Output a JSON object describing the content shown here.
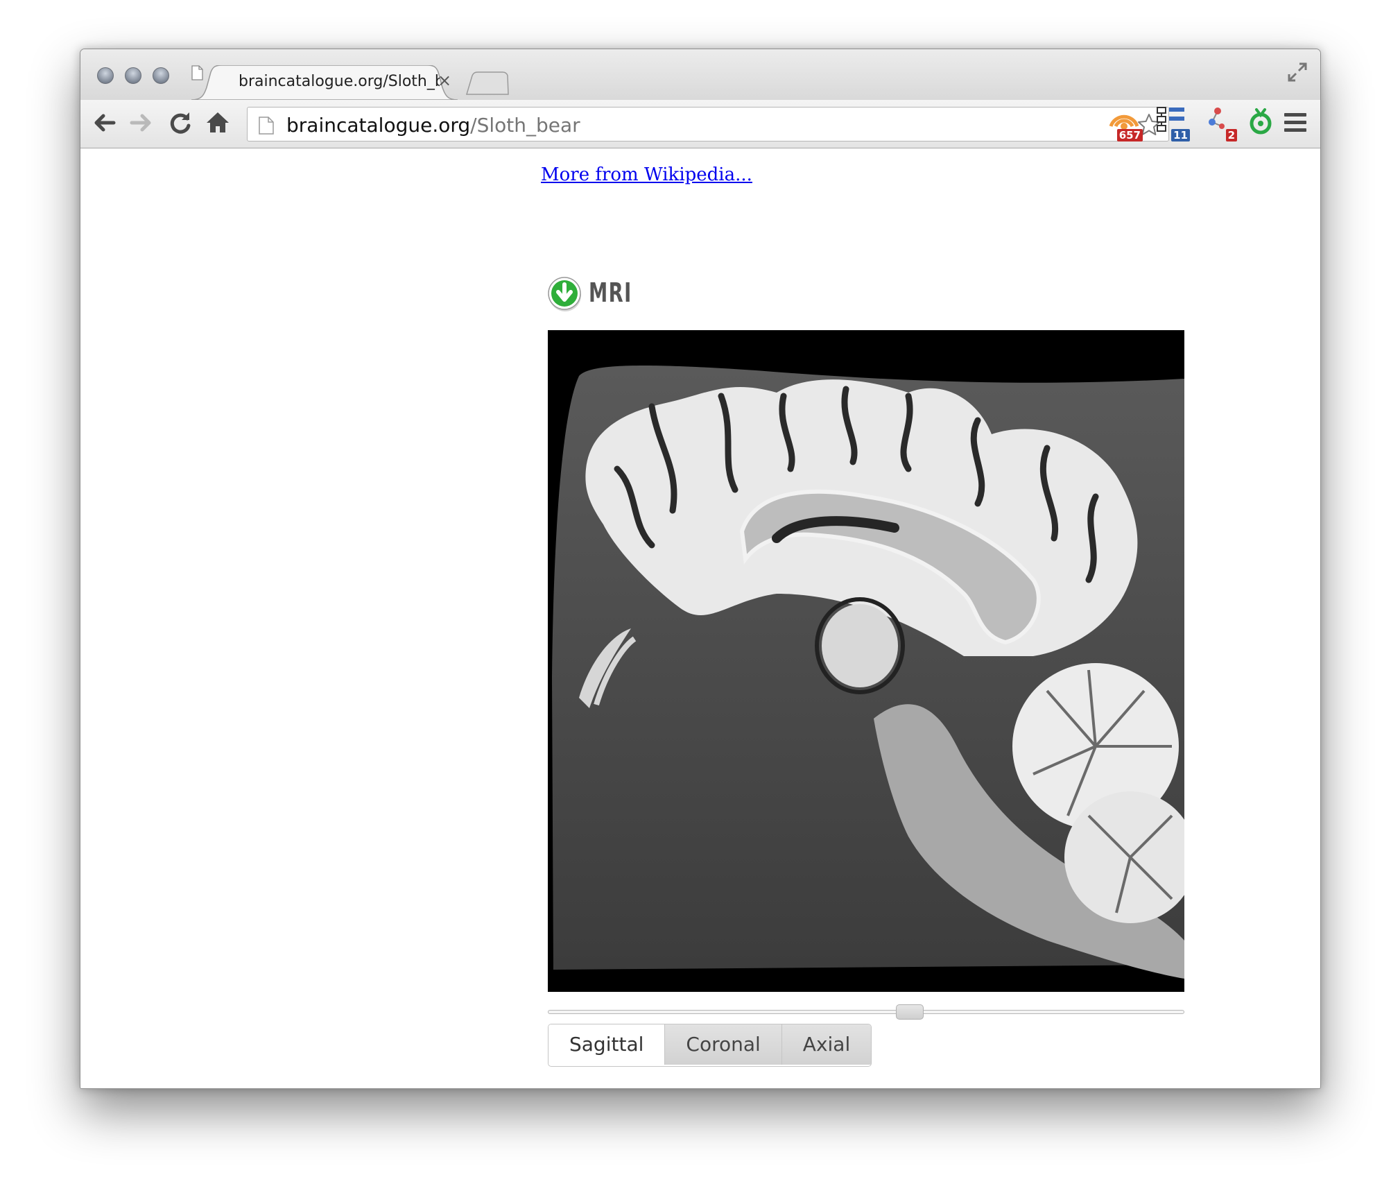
{
  "browser": {
    "tab": {
      "title": "braincatalogue.org/Sloth_b",
      "close_label": "×"
    },
    "omnibox": {
      "host": "braincatalogue.org",
      "path": "/Sloth_bear"
    },
    "extensions": [
      {
        "name": "rss-feed-icon",
        "badge": "657",
        "badge_color": "#c62828"
      },
      {
        "name": "tree-structure-icon",
        "badge": "11",
        "badge_color": "#2f5fa8"
      },
      {
        "name": "molecule-icon",
        "badge": "2",
        "badge_color": "#c62828"
      },
      {
        "name": "green-extension-icon",
        "badge": ""
      }
    ]
  },
  "page": {
    "wiki_link": "More from Wikipedia...",
    "section_title": "MRI",
    "viewer": {
      "image": "sagittal brain MRI slice",
      "slider_position": 0.58,
      "views": [
        {
          "label": "Sagittal",
          "active": true
        },
        {
          "label": "Coronal",
          "active": false
        },
        {
          "label": "Axial",
          "active": false
        }
      ]
    }
  }
}
